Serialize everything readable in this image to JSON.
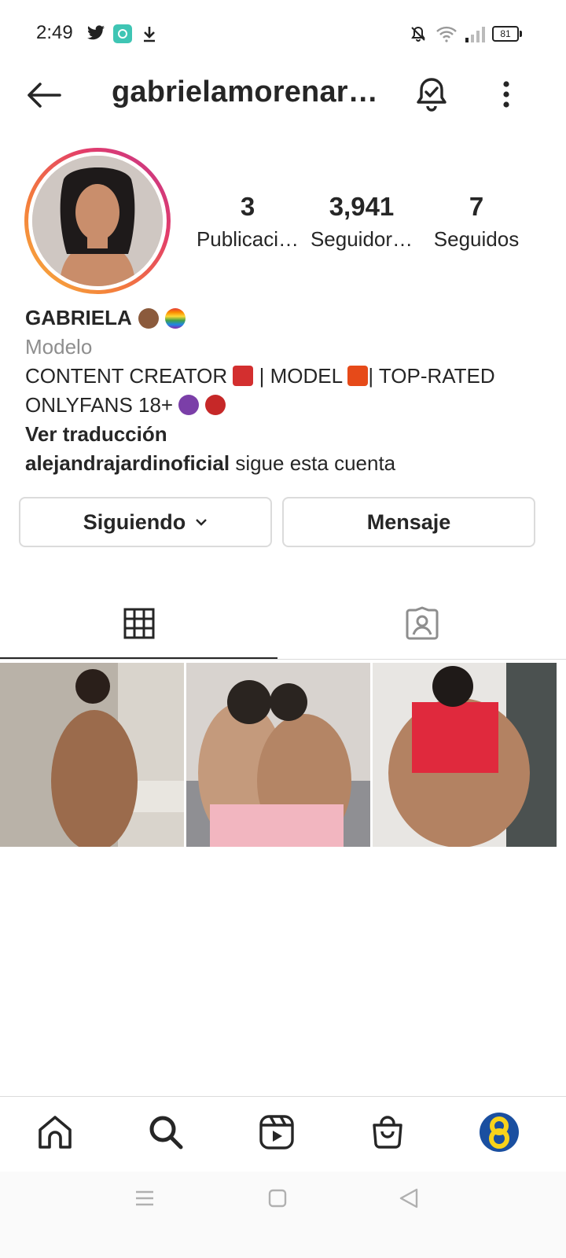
{
  "status_bar": {
    "time": "2:49",
    "battery": "81",
    "icons": [
      "twitter-icon",
      "app-notification-icon",
      "download-icon",
      "mute-notifications-icon",
      "wifi-icon",
      "signal-icon",
      "battery-icon"
    ]
  },
  "header": {
    "username": "gabrielamorenar…",
    "icons": [
      "back-arrow-icon",
      "notification-bell-icon",
      "more-options-icon"
    ]
  },
  "profile": {
    "stats": [
      {
        "value": "3",
        "label": "Publicaci…"
      },
      {
        "value": "3,941",
        "label": "Seguidor…"
      },
      {
        "value": "7",
        "label": "Seguidos"
      }
    ],
    "name": "GABRIELA",
    "category": "Modelo",
    "bio_line1": "CONTENT CREATOR",
    "bio_line1b": "| MODEL",
    "bio_line1c": "| TOP-RATED",
    "bio_line2": "ONLYFANS 18+",
    "translate": "Ver traducción",
    "followed_by_user": "alejandrajardinoficial",
    "followed_by_text": " sigue esta cuenta"
  },
  "actions": {
    "following_label": "Siguiendo",
    "message_label": "Mensaje"
  },
  "tabs": [
    "grid-icon",
    "tagged-icon"
  ],
  "bottom_nav": [
    "home-icon",
    "search-icon",
    "reels-icon",
    "shop-icon",
    "profile-avatar"
  ],
  "colors": {
    "text": "#262626",
    "secondary": "#8e8e8e",
    "border": "#dbdbdb",
    "ring_start": "#f8b53a",
    "ring_end": "#c0388e"
  }
}
